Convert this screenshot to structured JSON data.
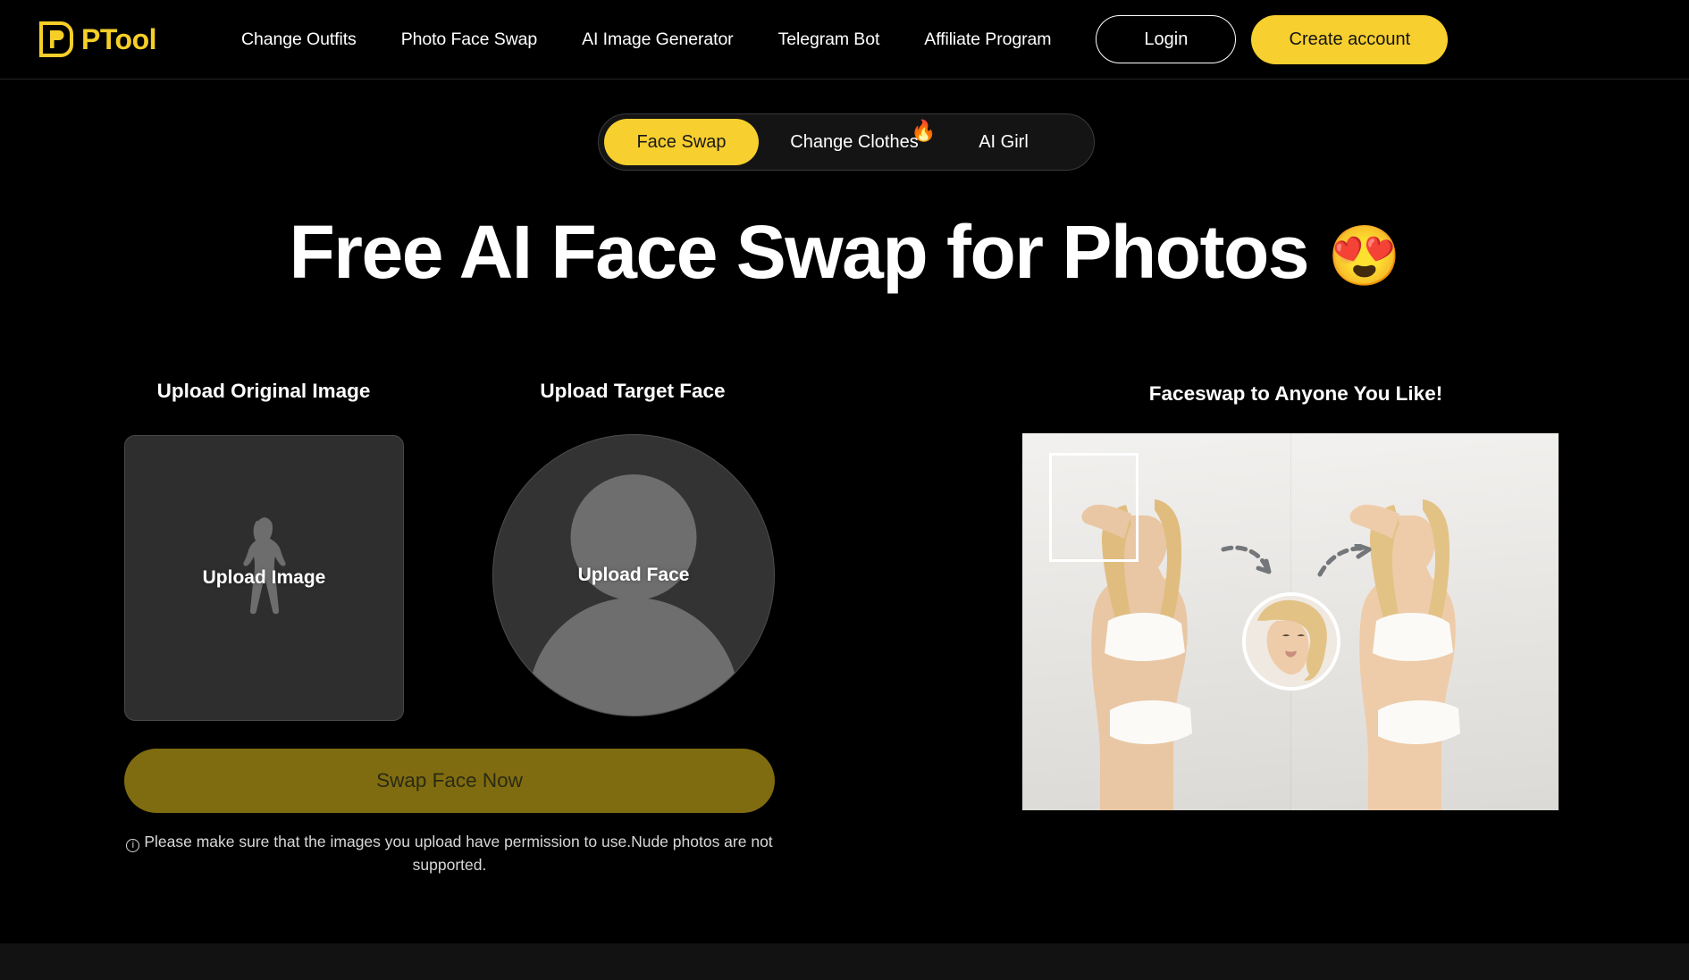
{
  "brand": {
    "name": "PTool",
    "logo_icon": "p-logo-icon",
    "accent_color": "#F7CF2E"
  },
  "header": {
    "nav": [
      {
        "label": "Change Outfits"
      },
      {
        "label": "Photo Face Swap"
      },
      {
        "label": "AI Image Generator"
      },
      {
        "label": "Telegram Bot"
      },
      {
        "label": "Affiliate Program"
      }
    ],
    "login_label": "Login",
    "create_account_label": "Create account"
  },
  "tabs": [
    {
      "label": "Face Swap",
      "active": true,
      "badge": ""
    },
    {
      "label": "Change Clothes",
      "active": false,
      "badge": "🔥"
    },
    {
      "label": "AI Girl",
      "active": false,
      "badge": ""
    }
  ],
  "hero": {
    "title": "Free AI Face Swap for Photos",
    "emoji": "😍"
  },
  "uploader": {
    "original": {
      "label": "Upload Original Image",
      "caption": "Upload Image",
      "icon": "body-silhouette-icon"
    },
    "target": {
      "label": "Upload Target Face",
      "caption": "Upload Face",
      "icon": "avatar-person-icon"
    },
    "submit_label": "Swap Face Now",
    "submit_disabled": true,
    "disclaimer": "Please make sure that the images you upload have permission to use.Nude photos are not supported.",
    "disclaimer_icon": "info-circle-icon"
  },
  "preview": {
    "title": "Faceswap to Anyone You Like!",
    "source_label": "",
    "result_label": "",
    "face_box_icon": "face-detect-box-icon",
    "arrow_icon": "curved-arrow-icon",
    "thumb_icon": "target-face-thumbnail-icon"
  },
  "colors": {
    "page_background": "#000000",
    "accent_yellow": "#F7CF2E",
    "accent_yellow_disabled": "#806C10",
    "panel_gray": "#2E2E2E",
    "circle_gray": "#333333",
    "footer_band": "#121212"
  }
}
